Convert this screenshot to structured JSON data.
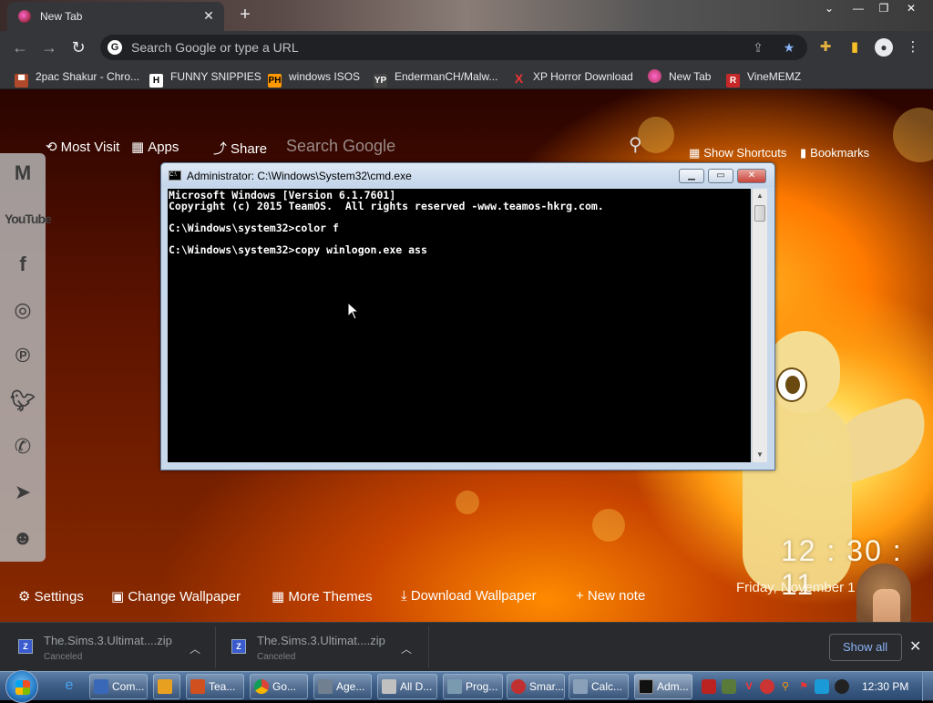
{
  "browser": {
    "tab_title": "New Tab",
    "omnibox_placeholder": "Search Google or type a URL",
    "bookmarks": [
      {
        "label": "2pac Shakur - Chro...",
        "icon": "car-icon"
      },
      {
        "label": "FUNNY SNIPPIES",
        "icon": "h-icon"
      },
      {
        "label": "windows ISOS",
        "icon": "ph-icon"
      },
      {
        "label": "EndermanCH/Malw...",
        "icon": "yp-icon"
      },
      {
        "label": "XP Horror Download",
        "icon": "x-icon"
      },
      {
        "label": "New Tab",
        "icon": "newtab-icon"
      },
      {
        "label": "VineMEMZ",
        "icon": "r-icon"
      }
    ]
  },
  "newtab": {
    "most_visited": "Most Visit",
    "apps": "Apps",
    "share": "Share",
    "search_label": "Search Google",
    "show_shortcuts": "Show Shortcuts",
    "bookmarks": "Bookmarks",
    "clock": "12 : 30 : 11",
    "date": "Friday, November 1",
    "settings": "Settings",
    "change_wallpaper": "Change Wallpaper",
    "more_themes": "More Themes",
    "download_wallpaper": "Download Wallpaper",
    "new_note": "+ New note",
    "social_icons": [
      "gmail-icon",
      "youtube-icon",
      "facebook-icon",
      "instagram-icon",
      "pinterest-icon",
      "twitter-icon",
      "whatsapp-icon",
      "telegram-icon",
      "reddit-icon"
    ],
    "youtube_text": "YouTube"
  },
  "cmd": {
    "title": "Administrator: C:\\Windows\\System32\\cmd.exe",
    "lines": [
      "Microsoft Windows [Version 6.1.7601]",
      "Copyright (c) 2015 TeamOS.  All rights reserved -www.teamos-hkrg.com.",
      "",
      "C:\\Windows\\system32>color f",
      "",
      "C:\\Windows\\system32>copy winlogon.exe ass"
    ]
  },
  "downloads": {
    "items": [
      {
        "name": "The.Sims.3.Ultimat....zip",
        "status": "Canceled"
      },
      {
        "name": "The.Sims.3.Ultimat....zip",
        "status": "Canceled"
      }
    ],
    "show_all": "Show all"
  },
  "taskbar": {
    "buttons": [
      {
        "label": "Com...",
        "color": "#3a68b8"
      },
      {
        "label": "",
        "color": "#e8a020"
      },
      {
        "label": "Tea...",
        "color": "#d05020"
      },
      {
        "label": "Go...",
        "color": "#dd4433"
      },
      {
        "label": "Age...",
        "color": "#708090"
      },
      {
        "label": "All D...",
        "color": "#c0c0c0"
      },
      {
        "label": "Prog...",
        "color": "#7a9ab0"
      },
      {
        "label": "Smar...",
        "color": "#c03030"
      },
      {
        "label": "Calc...",
        "color": "#8aa0b8"
      },
      {
        "label": "Adm...",
        "color": "#111111"
      }
    ],
    "time": "12:30 PM"
  }
}
